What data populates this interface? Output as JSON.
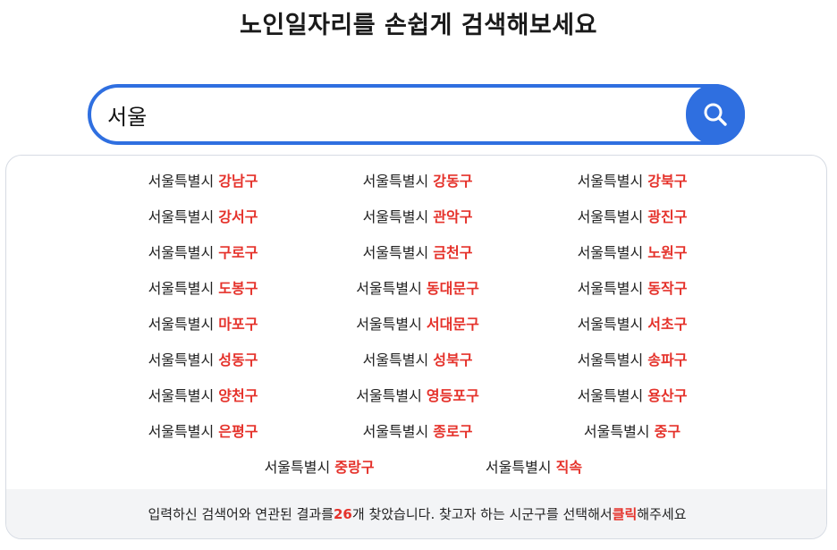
{
  "header": {
    "title": "노인일자리를 손쉽게 검색해보세요"
  },
  "search": {
    "value": "서울"
  },
  "city_label": "서울특별시",
  "results": [
    "강남구",
    "강동구",
    "강북구",
    "강서구",
    "관악구",
    "광진구",
    "구로구",
    "금천구",
    "노원구",
    "도봉구",
    "동대문구",
    "동작구",
    "마포구",
    "서대문구",
    "서초구",
    "성동구",
    "성북구",
    "송파구",
    "양천구",
    "영등포구",
    "용산구",
    "은평구",
    "종로구",
    "중구",
    "중랑구",
    "직속"
  ],
  "footer": {
    "prefix": "입력하신 검색어와 연관된 결과를 ",
    "count": "26",
    "middle": "개 찾았습니다. 찾고자 하는 시군구를 선택해서 ",
    "click": "클릭",
    "suffix": "해주세요"
  },
  "colors": {
    "accent": "#2f6fe0",
    "highlight": "#e5322b"
  },
  "icons": {
    "search_button": "search-icon"
  }
}
